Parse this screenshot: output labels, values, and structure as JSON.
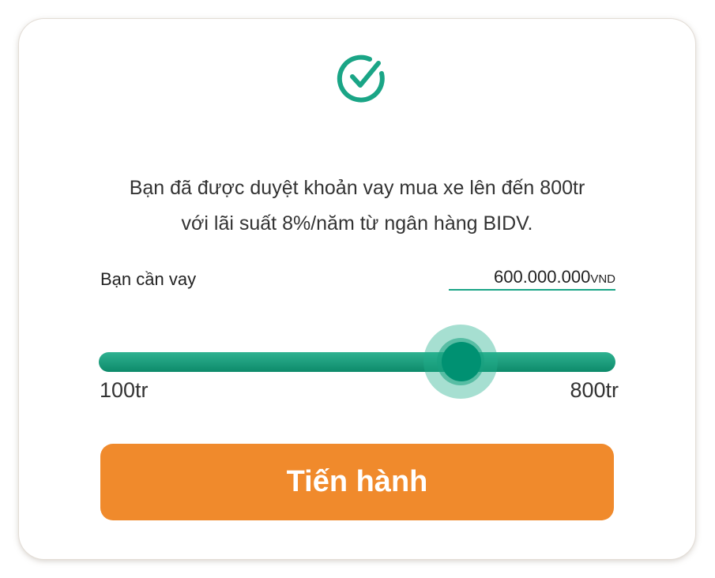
{
  "status": {
    "icon": "check-circle-icon",
    "icon_color": "#1aa586"
  },
  "message": {
    "line1": "Bạn đã được duyệt khoản vay mua xe lên đến 800tr",
    "line2": "với lãi suất 8%/năm từ ngân hàng BIDV."
  },
  "loan": {
    "label": "Bạn cần vay",
    "amount_value": "600.000.000",
    "amount_unit": "VND"
  },
  "slider": {
    "min_label": "100tr",
    "max_label": "800tr",
    "min": 100,
    "max": 800,
    "value": 600,
    "track_color": "#14997a",
    "thumb_color": "#009172"
  },
  "actions": {
    "proceed_label": "Tiến hành",
    "proceed_color": "#f08a2c"
  }
}
